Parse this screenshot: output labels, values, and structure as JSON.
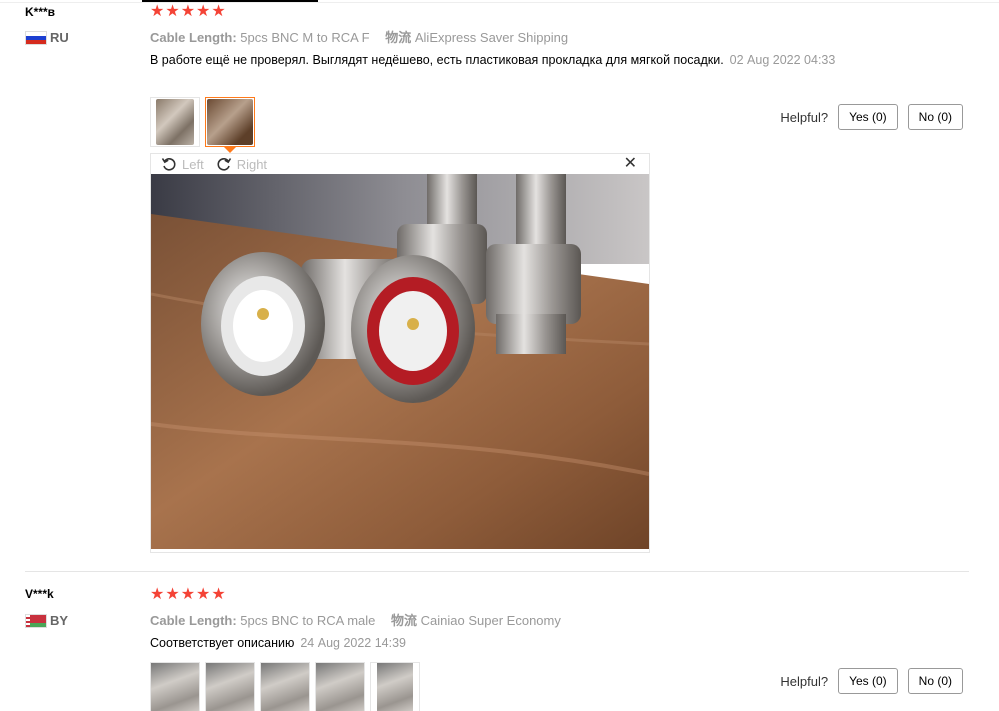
{
  "reviews": [
    {
      "user": "K***в",
      "country": "RU",
      "stars": 5,
      "cable_length_label": "Cable Length:",
      "cable_length": "5pcs BNC M to RCA F",
      "shipping_label": "物流",
      "shipping": "AliExpress Saver Shipping",
      "text": "В работе ещё не проверял. Выглядят недёшево, есть пластиковая прокладка для мягкой посадки.",
      "date": "02 Aug 2022 04:33",
      "helpful_label": "Helpful?",
      "yes_label": "Yes (0)",
      "no_label": "No (0)",
      "viewer": {
        "left_label": "Left",
        "right_label": "Right",
        "close": "✕"
      }
    },
    {
      "user": "V***k",
      "country": "BY",
      "stars": 5,
      "cable_length_label": "Cable Length:",
      "cable_length": "5pcs BNC to RCA male",
      "shipping_label": "物流",
      "shipping": "Cainiao Super Economy",
      "text": "Соответствует описанию",
      "date": "24 Aug 2022 14:39",
      "helpful_label": "Helpful?",
      "yes_label": "Yes (0)",
      "no_label": "No (0)"
    }
  ],
  "icons": {
    "star": "★",
    "rotate_left": "rotate-left-icon",
    "rotate_right": "rotate-right-icon",
    "close": "close-icon"
  },
  "colors": {
    "star": "#f44336",
    "active_thumb": "#ff7a1a"
  }
}
